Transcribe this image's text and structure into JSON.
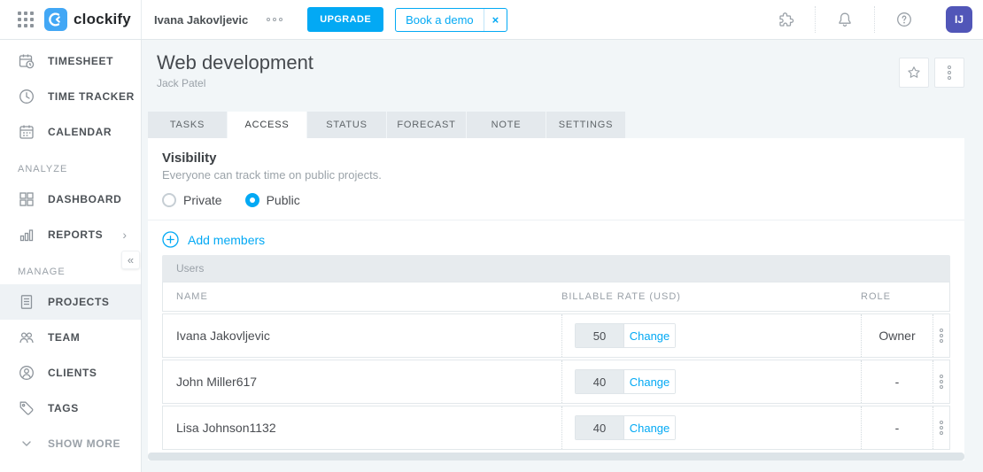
{
  "colors": {
    "primary": "#03a9f4",
    "avatar_bg": "#5156b8"
  },
  "topbar": {
    "brand": "clockify",
    "workspace_name": "Ivana Jakovljevic",
    "upgrade_label": "UPGRADE",
    "book_demo": {
      "label": "Book a demo",
      "close_icon": "×"
    },
    "avatar_initials": "IJ"
  },
  "sidebar": {
    "section_analyze": "ANALYZE",
    "section_manage": "MANAGE",
    "collapse_icon": "«",
    "reports_chevron": "›",
    "items": [
      {
        "label": "TIMESHEET"
      },
      {
        "label": "TIME TRACKER"
      },
      {
        "label": "CALENDAR"
      },
      {
        "label": "DASHBOARD"
      },
      {
        "label": "REPORTS"
      },
      {
        "label": "PROJECTS"
      },
      {
        "label": "TEAM"
      },
      {
        "label": "CLIENTS"
      },
      {
        "label": "TAGS"
      },
      {
        "label": "SHOW MORE"
      }
    ]
  },
  "header": {
    "title": "Web development",
    "subtitle": "Jack Patel"
  },
  "tabs": [
    {
      "label": "TASKS"
    },
    {
      "label": "ACCESS"
    },
    {
      "label": "STATUS"
    },
    {
      "label": "FORECAST"
    },
    {
      "label": "NOTE"
    },
    {
      "label": "SETTINGS"
    }
  ],
  "active_tab": "ACCESS",
  "visibility": {
    "heading": "Visibility",
    "description": "Everyone can track time on public projects.",
    "private_label": "Private",
    "public_label": "Public",
    "selected": "Public"
  },
  "members": {
    "add_label": "Add members",
    "group_label": "Users",
    "columns": {
      "name": "NAME",
      "rate": "BILLABLE RATE (USD)",
      "role": "ROLE"
    },
    "rows": [
      {
        "name": "Ivana Jakovljevic",
        "rate": "50",
        "change_label": "Change",
        "role": "Owner"
      },
      {
        "name": "John Miller617",
        "rate": "40",
        "change_label": "Change",
        "role": "-"
      },
      {
        "name": "Lisa Johnson1132",
        "rate": "40",
        "change_label": "Change",
        "role": "-"
      }
    ]
  }
}
